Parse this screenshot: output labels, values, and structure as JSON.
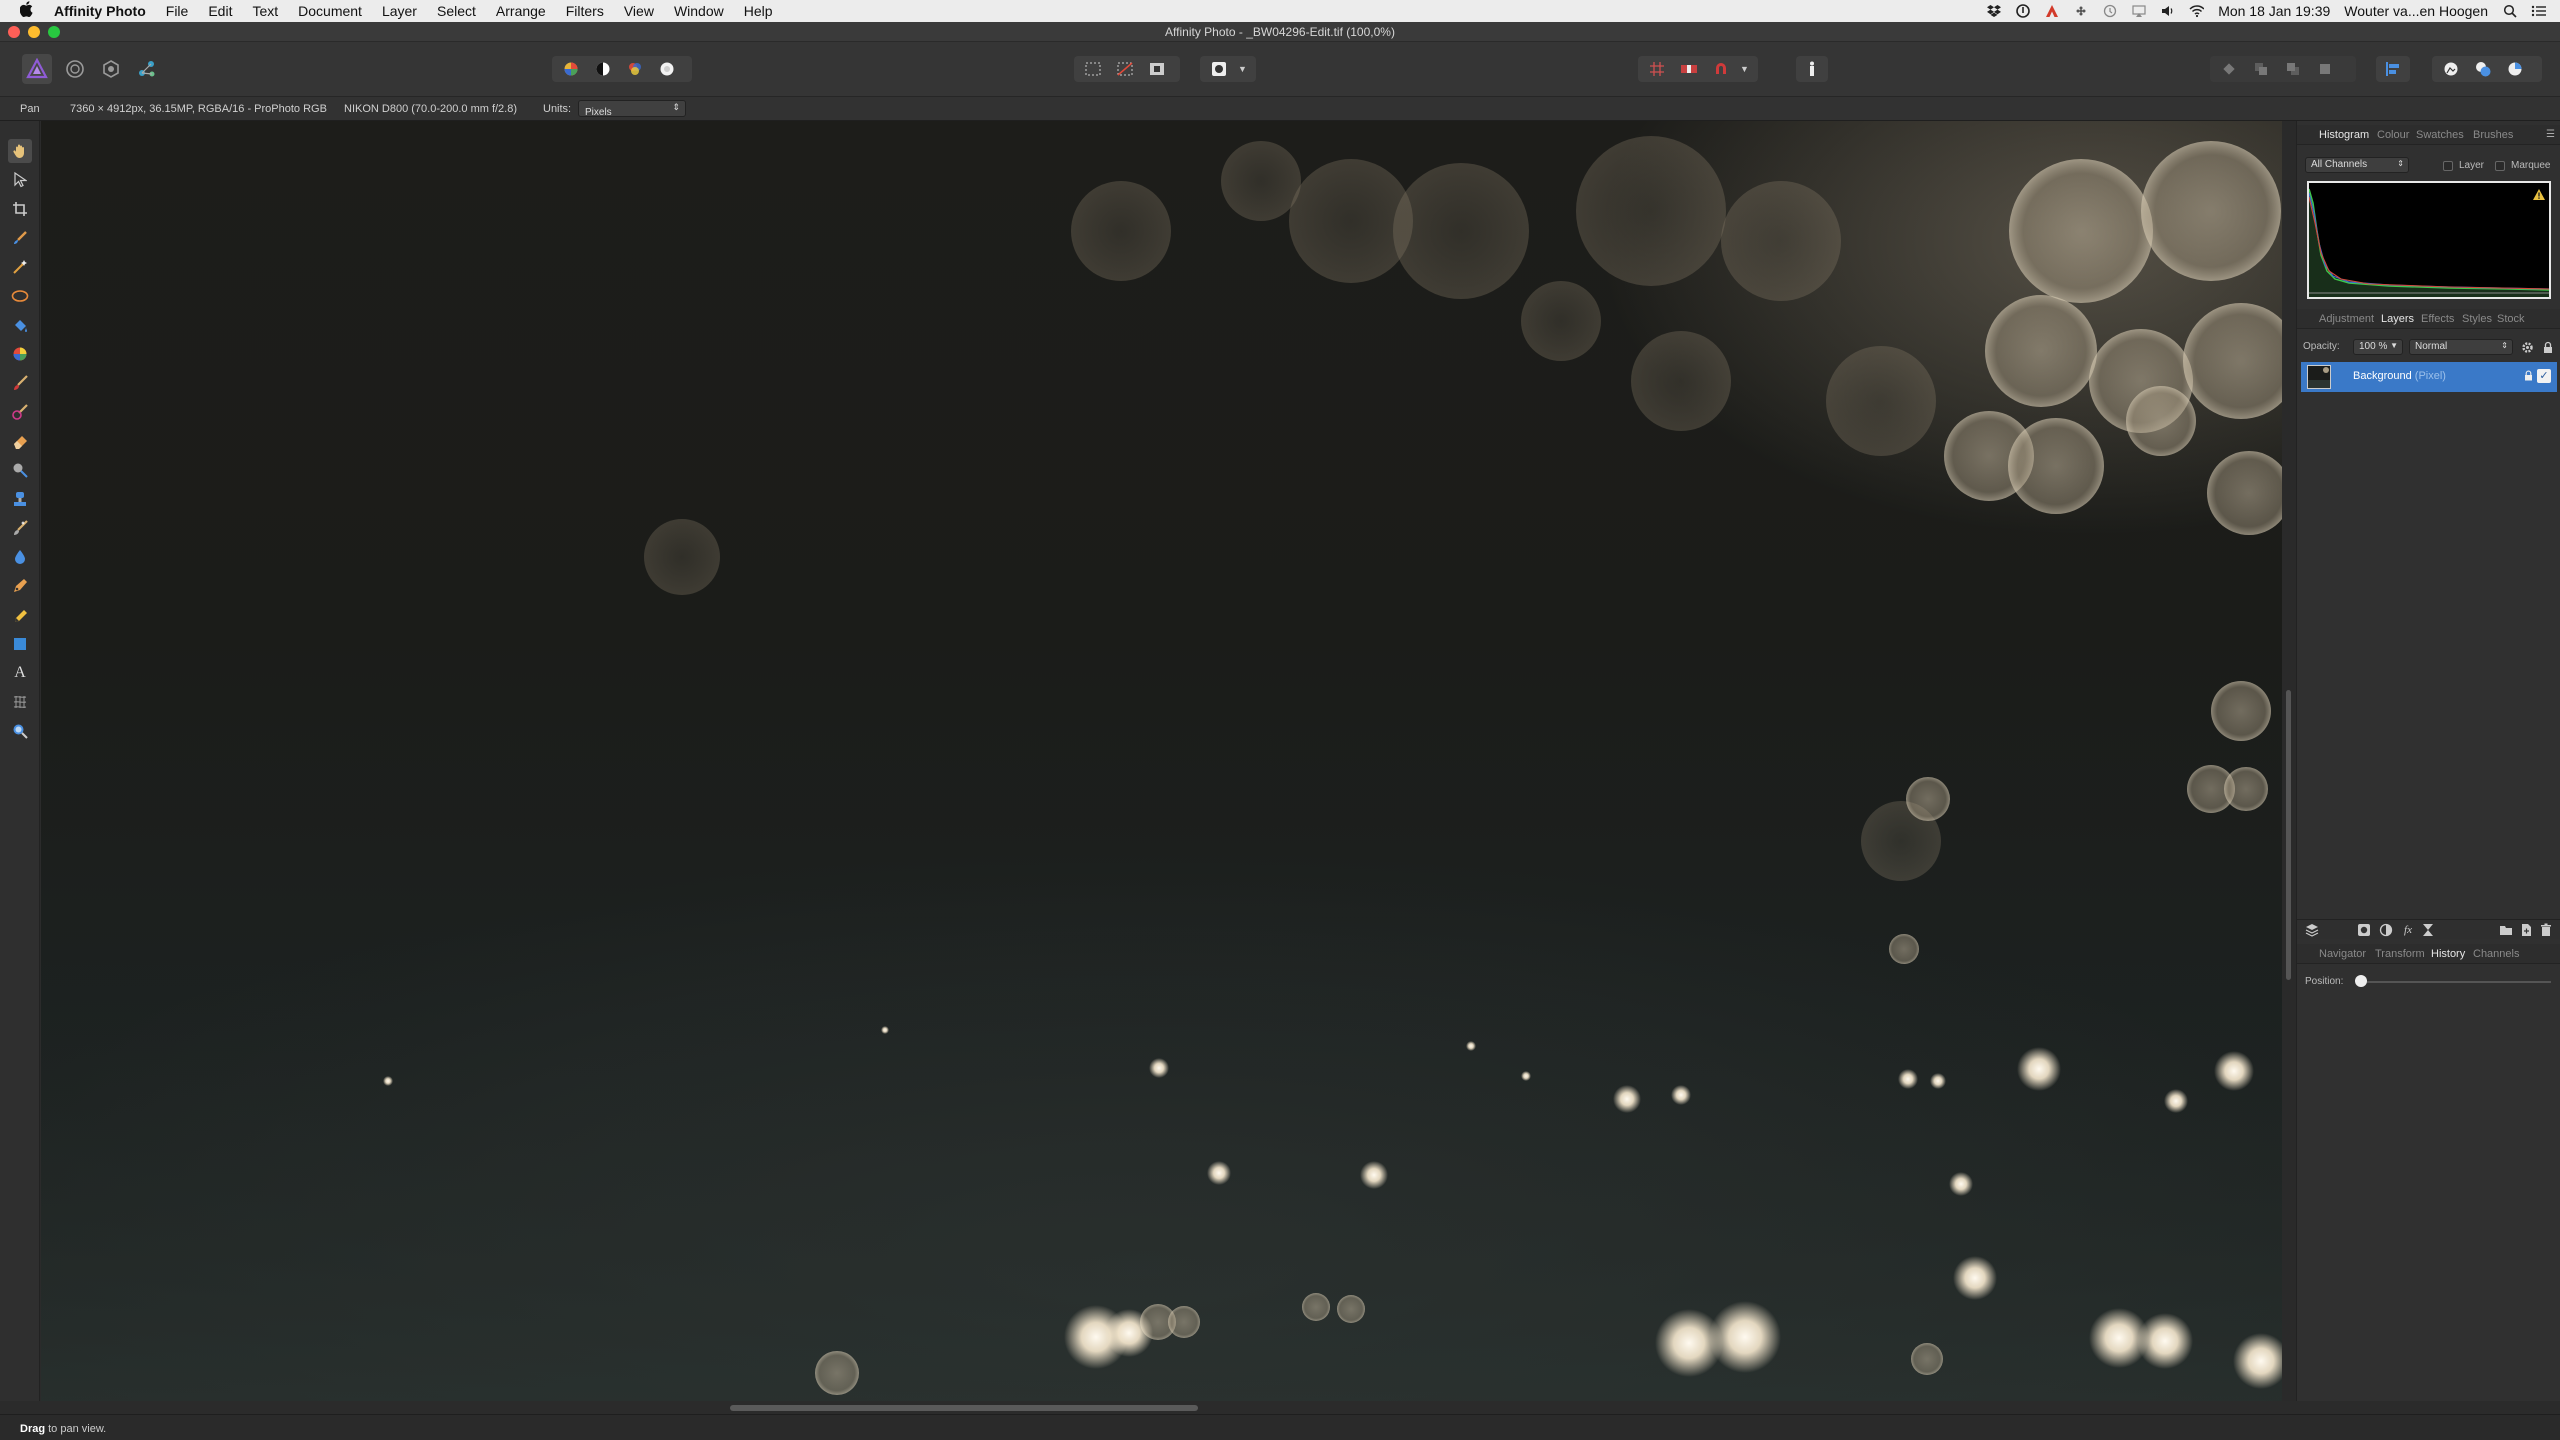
{
  "menubar": {
    "app_name": "Affinity Photo",
    "items": [
      "File",
      "Edit",
      "Text",
      "Document",
      "Layer",
      "Select",
      "Arrange",
      "Filters",
      "View",
      "Window",
      "Help"
    ],
    "clock": "Mon 18 Jan  19:39",
    "user": "Wouter va...en Hoogen"
  },
  "window": {
    "title": "Affinity Photo - _BW04296-Edit.tif (100,0%)"
  },
  "context": {
    "tool": "Pan",
    "doc_info": "7360 × 4912px, 36.15MP, RGBA/16 - ProPhoto RGB",
    "camera": "NIKON D800 (70.0-200.0 mm f/2.8)",
    "units_label": "Units:",
    "units_value": "Pixels"
  },
  "histogram_panel": {
    "tabs": [
      "Histogram",
      "Colour",
      "Swatches",
      "Brushes"
    ],
    "active_tab": "Histogram",
    "channel_select": "All Channels",
    "layer_label": "Layer",
    "marquee_label": "Marquee",
    "warning_icon": "warning-icon"
  },
  "layers_panel": {
    "tabs": [
      "Adjustment",
      "Layers",
      "Effects",
      "Styles",
      "Stock"
    ],
    "active_tab": "Layers",
    "opacity_label": "Opacity:",
    "opacity_value": "100 %",
    "blend_mode": "Normal",
    "layer": {
      "name": "Background",
      "type": "(Pixel)"
    }
  },
  "history_panel": {
    "tabs": [
      "Navigator",
      "Transform",
      "History",
      "Channels"
    ],
    "active_tab": "History",
    "position_label": "Position:",
    "position_value": 0
  },
  "status": {
    "hint_bold": "Drag",
    "hint_text": " to pan view."
  },
  "colors": {
    "selection_blue": "#3a79c8",
    "persona_photo": "#8f5bd6",
    "ui_background": "#2f2f2f"
  }
}
